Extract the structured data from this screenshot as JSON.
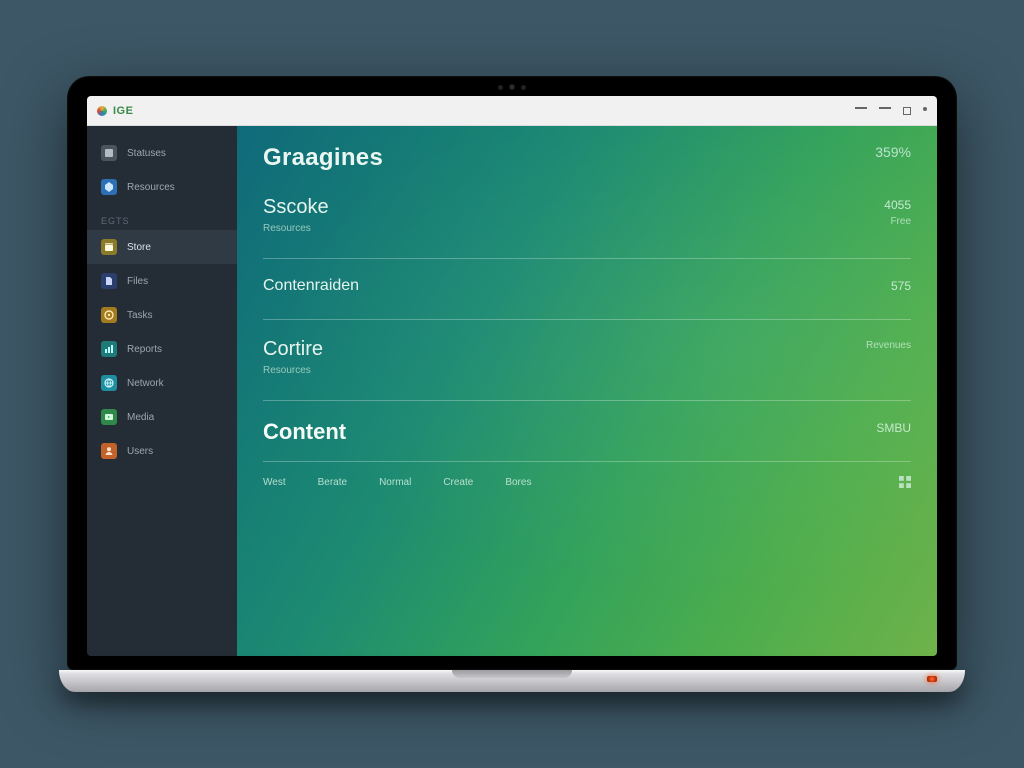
{
  "titlebar": {
    "brand": "IGE"
  },
  "sidebar": {
    "top": [
      {
        "label": "Statuses"
      },
      {
        "label": "Resources"
      }
    ],
    "section_label": "EGTS",
    "items": [
      {
        "label": "Store"
      },
      {
        "label": "Files"
      },
      {
        "label": "Tasks"
      },
      {
        "label": "Reports"
      },
      {
        "label": "Network"
      },
      {
        "label": "Media"
      },
      {
        "label": "Users"
      }
    ]
  },
  "header": {
    "title": "Graagines",
    "meta_top": "359%",
    "meta_mid": "4055",
    "meta_small": "Free"
  },
  "sections": [
    {
      "title": "Sscoke",
      "subtitle": "Resources",
      "right": ""
    },
    {
      "title": "Contenraiden",
      "subtitle": "",
      "right": "575"
    },
    {
      "title": "Cortire",
      "subtitle": "Resources",
      "right": "Revenues"
    },
    {
      "title": "Content",
      "subtitle": "",
      "right": "SMBU"
    }
  ],
  "tabs": {
    "items": [
      "West",
      "Berate",
      "Normal",
      "Create",
      "Bores"
    ]
  }
}
